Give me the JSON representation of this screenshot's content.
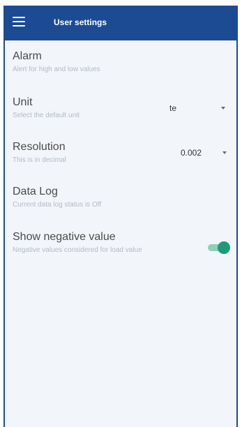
{
  "appbar": {
    "title": "User settings",
    "menu_icon": "hamburger-menu-icon"
  },
  "settings": {
    "alarm": {
      "title": "Alarm",
      "subtitle": "Alert for high and low values"
    },
    "unit": {
      "title": "Unit",
      "subtitle": "Select the default unit",
      "selected": "te"
    },
    "resolution": {
      "title": "Resolution",
      "subtitle": "This is in decimal",
      "selected": "0.002"
    },
    "data_log": {
      "title": "Data Log",
      "subtitle": "Current data log status is Off"
    },
    "show_negative": {
      "title": "Show negative value",
      "subtitle": "Negative values considered for load value",
      "enabled": true
    }
  },
  "colors": {
    "appbar": "#1d4b93",
    "toggle_on": "#1f9a78",
    "toggle_track": "#8fd0b9",
    "background": "#f2f5fa"
  }
}
